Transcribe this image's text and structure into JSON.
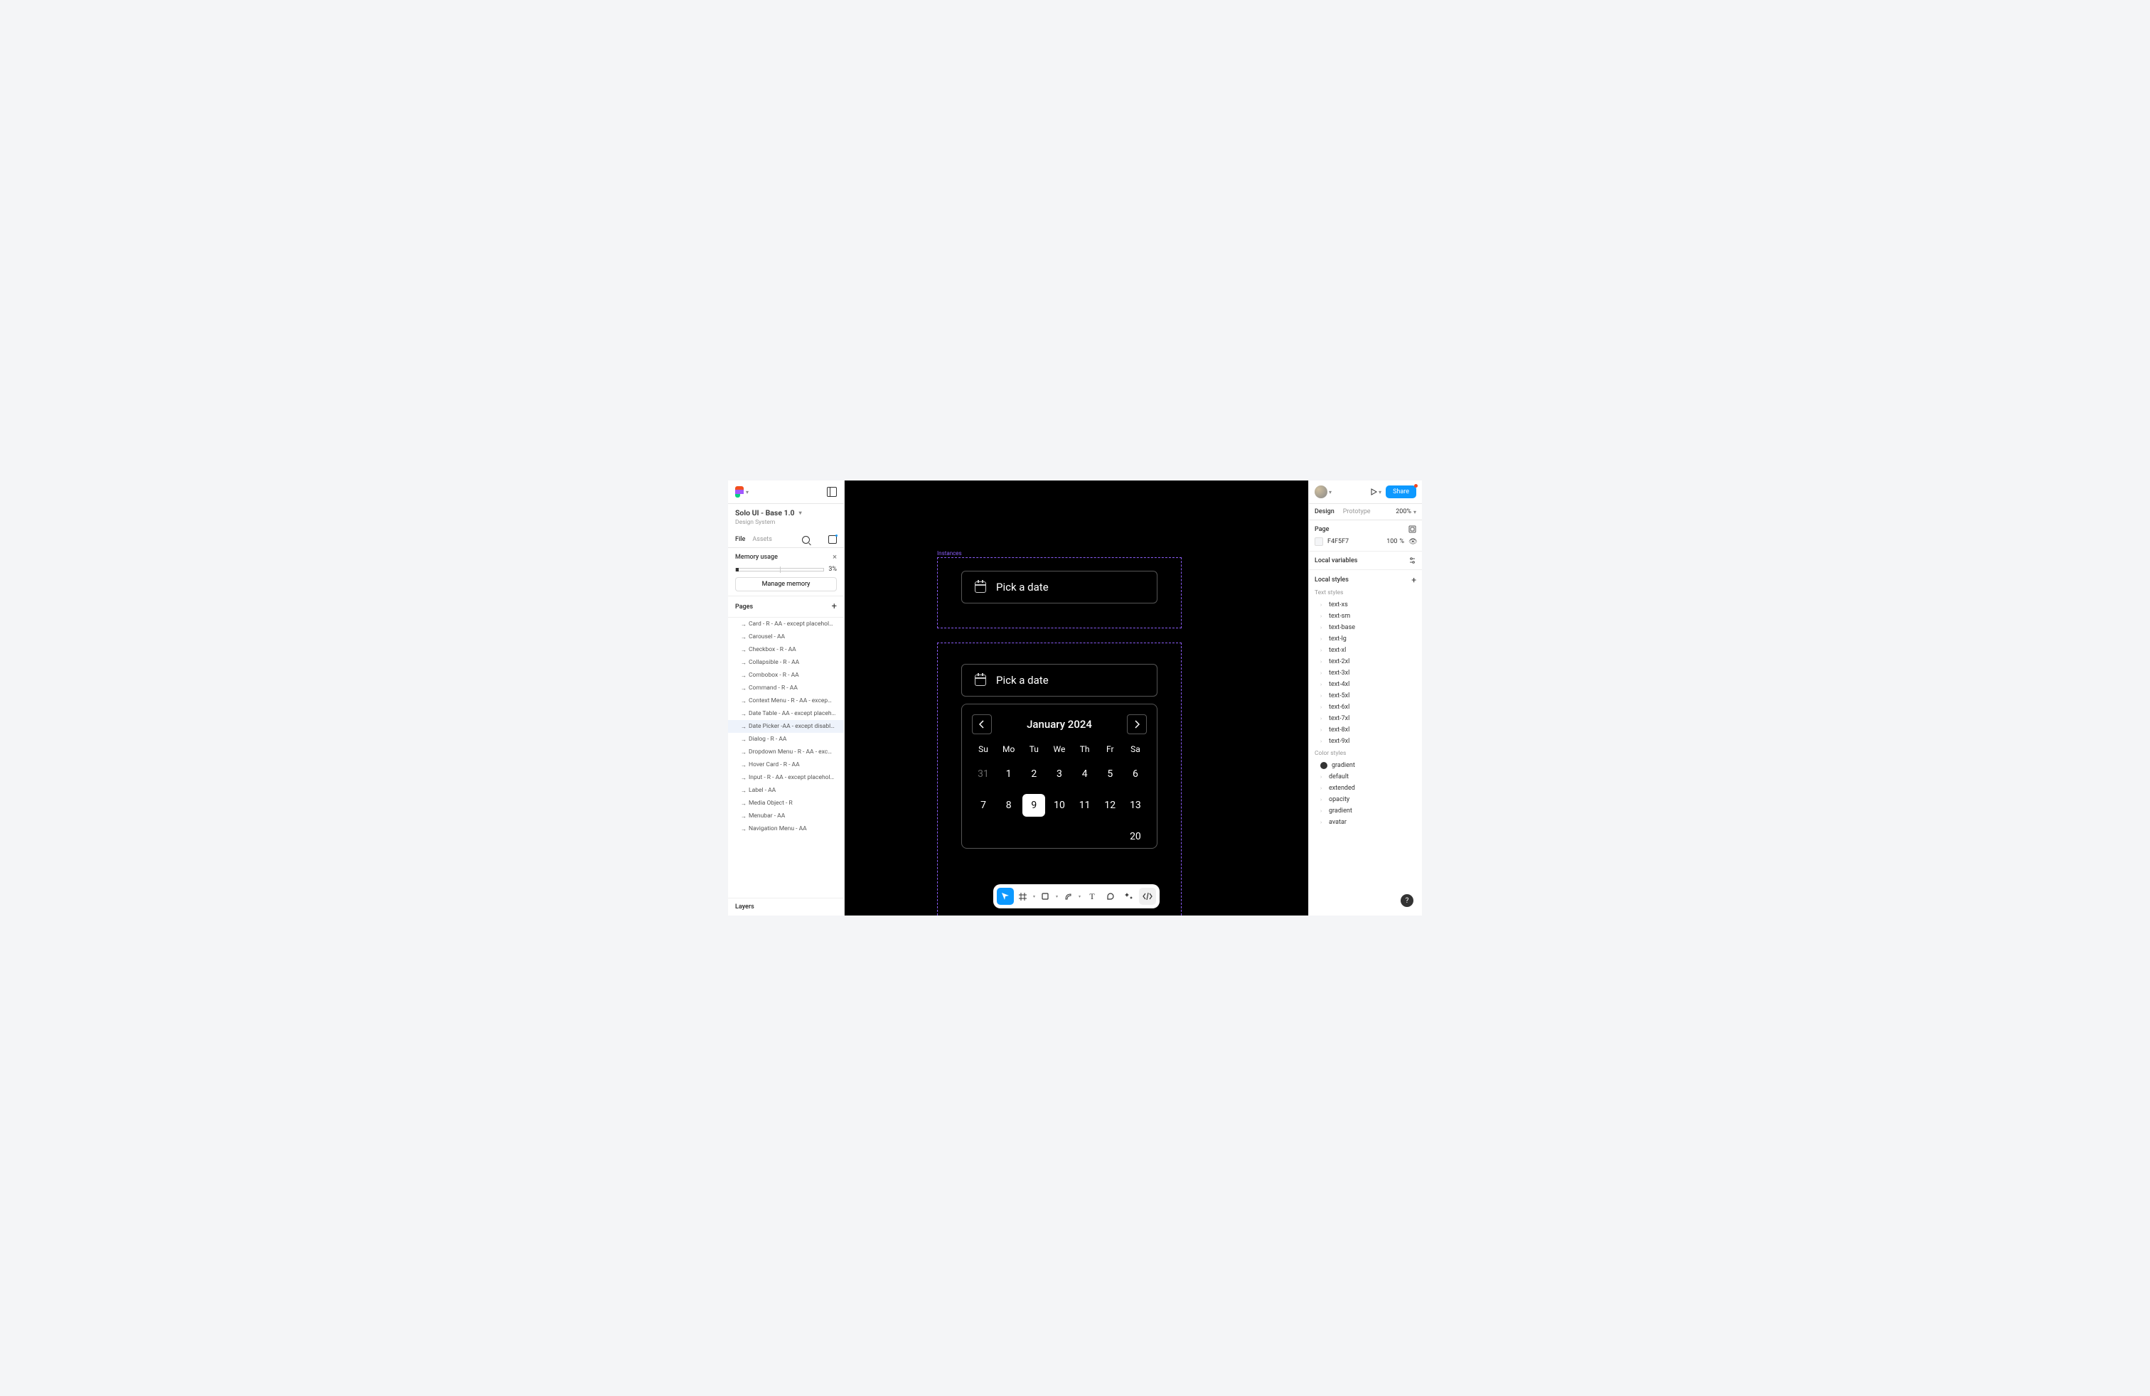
{
  "leftPanel": {
    "fileName": "Solo UI - Base 1.0",
    "project": "Design System",
    "tabs": {
      "file": "File",
      "assets": "Assets"
    },
    "memory": {
      "title": "Memory usage",
      "percent": "3%",
      "manage": "Manage memory"
    },
    "pagesTitle": "Pages",
    "pages": [
      "Card - R - AA - except placehol…",
      "Carousel  - AA",
      "Checkbox - R - AA",
      "Collapsible - R - AA",
      "Combobox - R - AA",
      "Command - R - AA",
      "Context Menu - R - AA - excep…",
      "Date Table - AA - except placeh…",
      "Date Picker -AA - except disabl…",
      "Dialog - R - AA",
      "Dropdown Menu - R - AA - exc…",
      "Hover Card - R - AA",
      "Input - R - AA - except placehol…",
      "Label - AA",
      "Media Object - R",
      "Menubar - AA",
      "Navigation Menu - AA"
    ],
    "selectedPageIndex": 8,
    "layersTitle": "Layers"
  },
  "canvas": {
    "instancesLabel": "Instances",
    "trigger1": "Pick a date",
    "trigger2": "Pick a date",
    "monthLabel": "January 2024",
    "dow": [
      "Su",
      "Mo",
      "Tu",
      "We",
      "Th",
      "Fr",
      "Sa"
    ],
    "rows": [
      [
        "31",
        "1",
        "2",
        "3",
        "4",
        "5",
        "6"
      ],
      [
        "7",
        "8",
        "9",
        "10",
        "11",
        "12",
        "13"
      ]
    ],
    "partialRow": [
      "",
      "",
      "",
      "",
      "",
      "",
      "20"
    ],
    "selectedDay": "9",
    "mutedDay": "31"
  },
  "rightPanel": {
    "tabs": {
      "design": "Design",
      "prototype": "Prototype"
    },
    "zoom": "200%",
    "share": "Share",
    "pageSection": {
      "title": "Page",
      "color": "F4F5F7",
      "opacity": "100",
      "unit": "%"
    },
    "localVars": "Local variables",
    "localStyles": "Local styles",
    "textStylesTitle": "Text styles",
    "textStyles": [
      "text-xs",
      "text-sm",
      "text-base",
      "text-lg",
      "text-xl",
      "text-2xl",
      "text-3xl",
      "text-4xl",
      "text-5xl",
      "text-6xl",
      "text-7xl",
      "text-8xl",
      "text-9xl"
    ],
    "colorStylesTitle": "Color styles",
    "colorStyles": [
      "gradient",
      "default",
      "extended",
      "opacity",
      "gradient",
      "avatar"
    ]
  }
}
